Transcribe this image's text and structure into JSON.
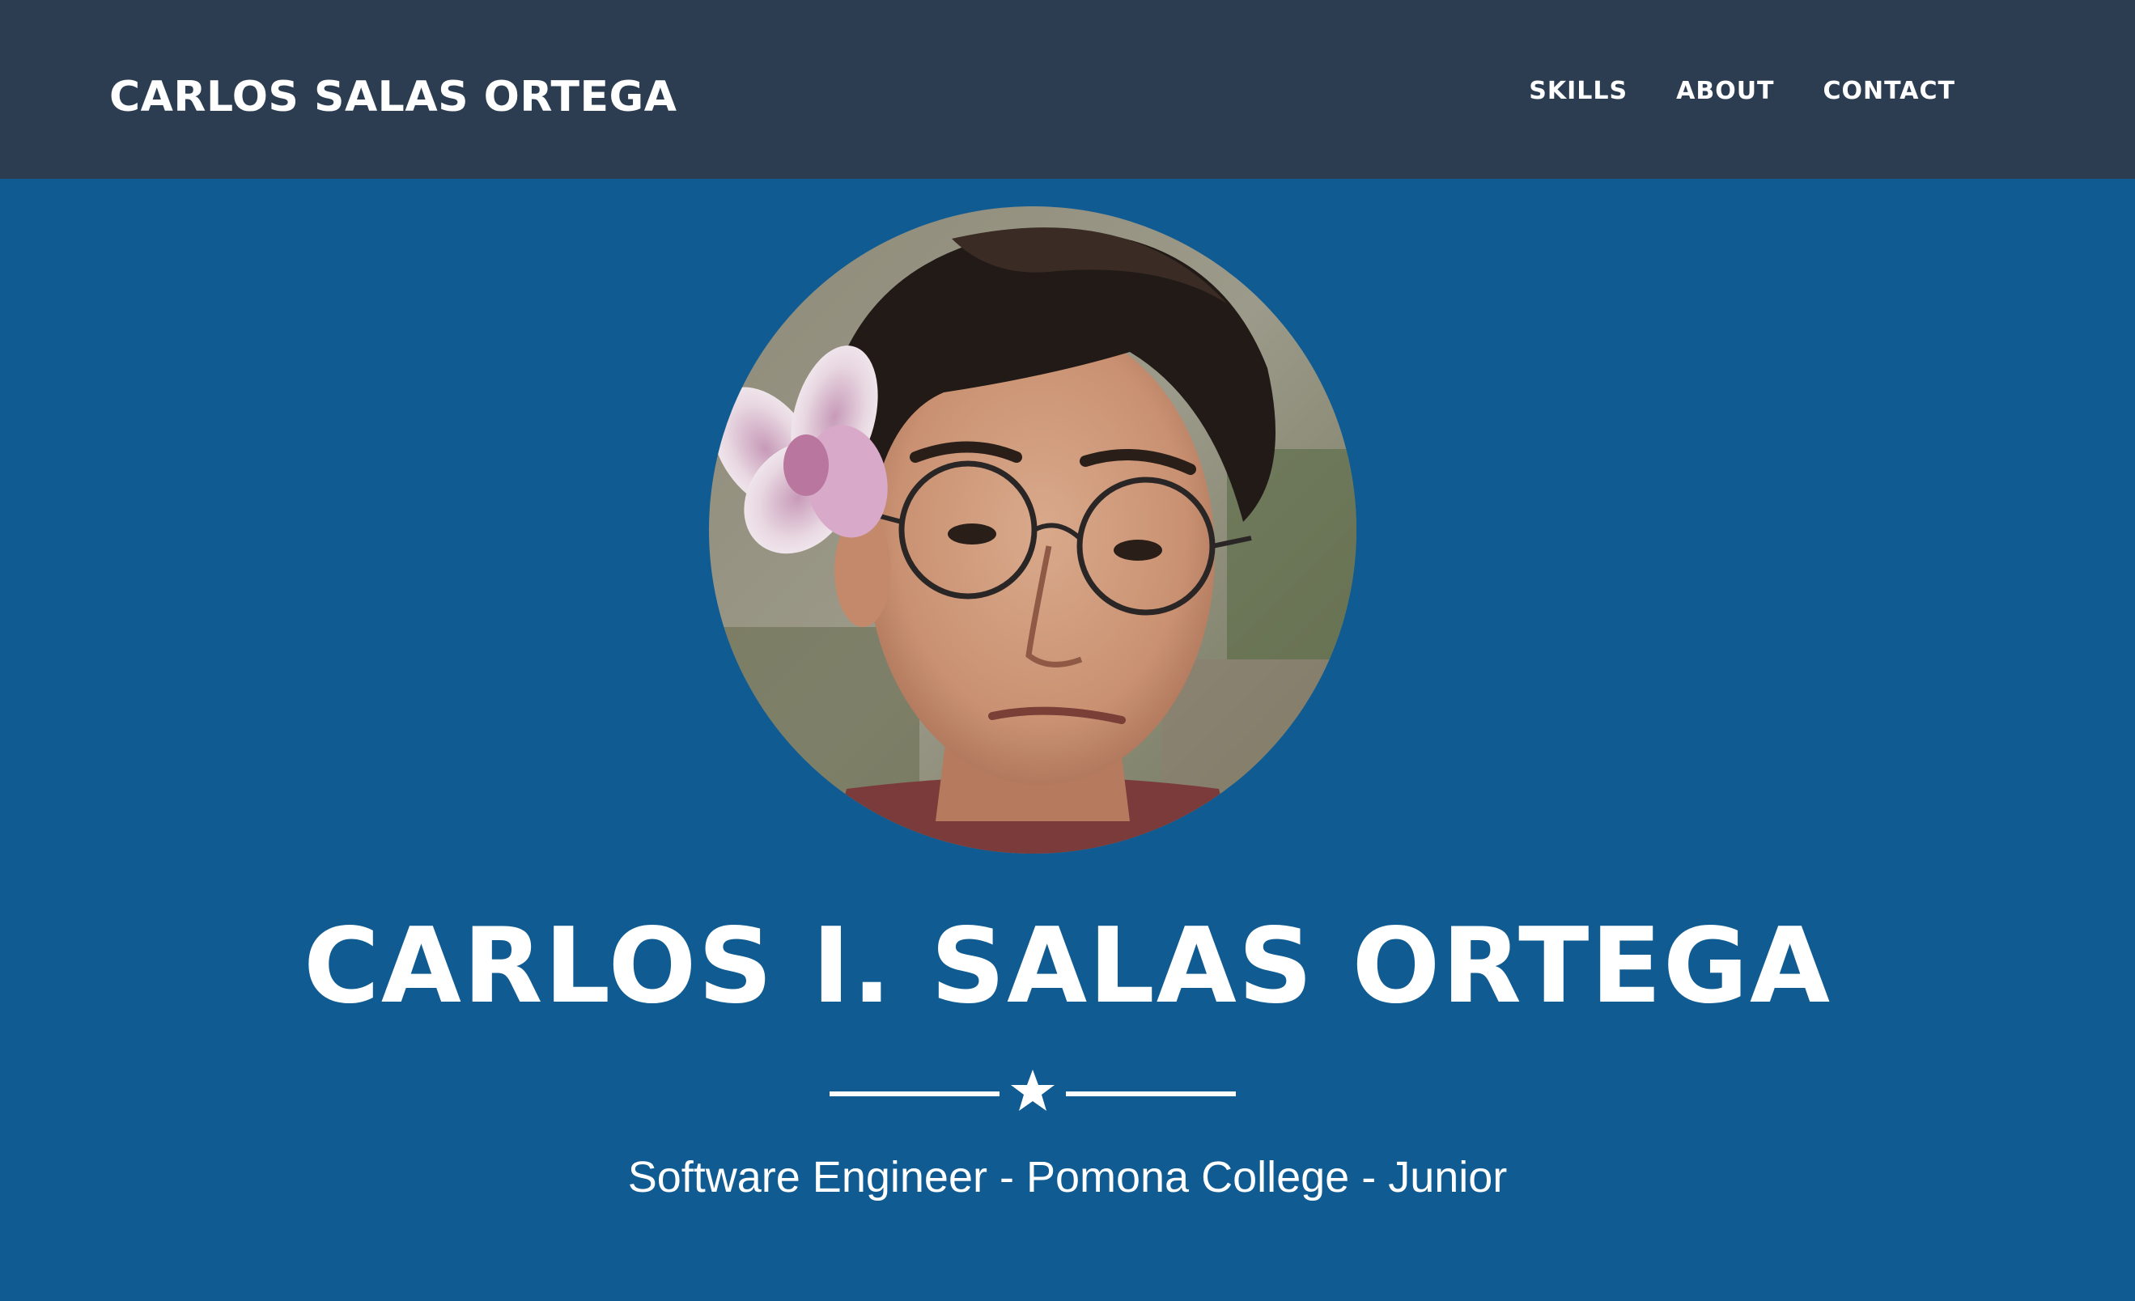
{
  "navbar": {
    "brand": "CARLOS SALAS ORTEGA",
    "links": [
      {
        "label": "SKILLS"
      },
      {
        "label": "ABOUT"
      },
      {
        "label": "CONTACT"
      }
    ]
  },
  "hero": {
    "name": "CARLOS I. SALAS ORTEGA",
    "divider_icon": "star-icon",
    "subtitle": "Software Engineer - Pomona College - Junior",
    "avatar_alt": "profile-photo"
  },
  "colors": {
    "navbar_bg": "#2d3d51",
    "hero_bg": "#105c92",
    "text": "#ffffff"
  }
}
